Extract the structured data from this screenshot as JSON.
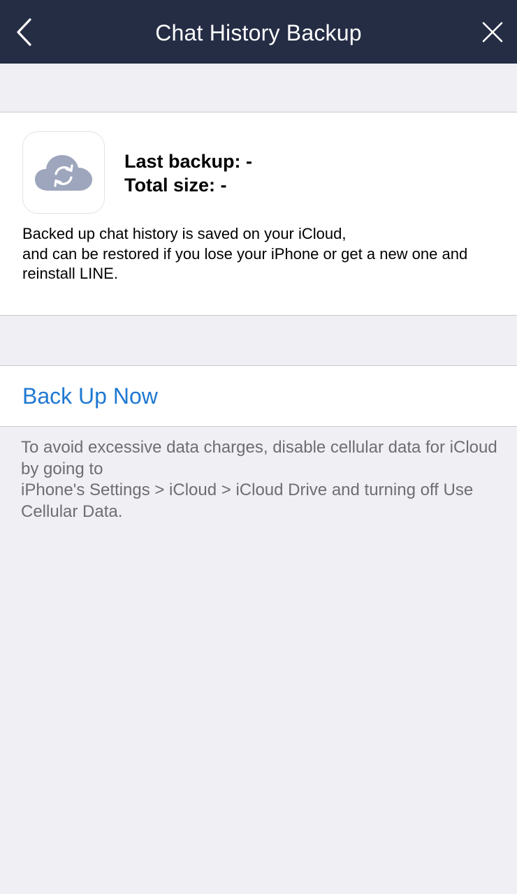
{
  "header": {
    "title": "Chat History Backup",
    "back_icon": "chevron-left-icon",
    "close_icon": "close-icon"
  },
  "backup_info": {
    "icon": "cloud-sync-icon",
    "last_backup": "Last backup: -",
    "total_size": "Total size: -",
    "description": "Backed up chat history is saved on your iCloud,\nand can be restored if you lose your iPhone or get a new one and reinstall LINE."
  },
  "actions": {
    "backup_now_label": "Back Up Now"
  },
  "footnote": "To avoid excessive data charges, disable cellular data for iCloud by going to\niPhone's Settings > iCloud > iCloud Drive and turning off Use Cellular Data.",
  "colors": {
    "navbar": "#252d45",
    "accent": "#1f78d1",
    "background": "#efeff4",
    "cloud_icon": "#9ea6bd"
  }
}
